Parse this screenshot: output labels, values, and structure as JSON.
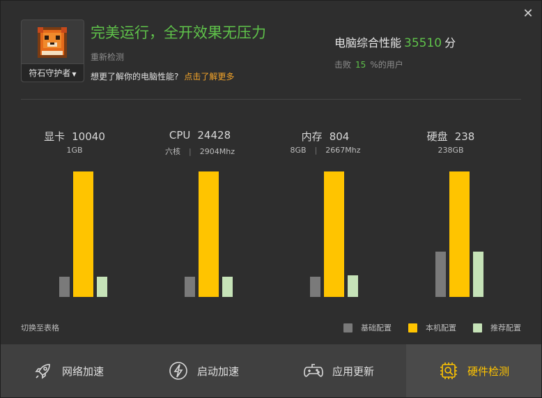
{
  "header": {
    "avatar_label": "符石守护者",
    "headline": "完美运行，全开效果无压力",
    "recheck": "重新检测",
    "learn_text": "想更了解你的电脑性能?",
    "learn_link": "点击了解更多",
    "score_label": "电脑综合性能",
    "score_value": "35510",
    "score_unit": "分",
    "beat_prefix": "击败",
    "beat_value": "15",
    "beat_suffix": "%的用户"
  },
  "chart_data": {
    "type": "bar",
    "categories": [
      "显卡",
      "CPU",
      "内存",
      "硬盘"
    ],
    "scores": [
      "10040",
      "24428",
      "804",
      "238"
    ],
    "specs": [
      [
        "1GB"
      ],
      [
        "六核",
        "2904Mhz"
      ],
      [
        "8GB",
        "2667Mhz"
      ],
      [
        "238GB"
      ]
    ],
    "series": [
      {
        "name": "基础配置",
        "values": [
          0.16,
          0.16,
          0.16,
          0.36
        ]
      },
      {
        "name": "本机配置",
        "values": [
          1.0,
          1.0,
          1.0,
          1.0
        ]
      },
      {
        "name": "推荐配置",
        "values": [
          0.16,
          0.16,
          0.17,
          0.36
        ]
      }
    ],
    "colors": [
      "#7a7a7a",
      "#ffc400",
      "#c6e3b8"
    ]
  },
  "footer": {
    "switch": "切换至表格",
    "legend": [
      "基础配置",
      "本机配置",
      "推荐配置"
    ]
  },
  "nav": [
    {
      "label": "网络加速",
      "icon": "rocket-icon"
    },
    {
      "label": "启动加速",
      "icon": "lightning-icon"
    },
    {
      "label": "应用更新",
      "icon": "gamepad-icon"
    },
    {
      "label": "硬件检测",
      "icon": "chip-search-icon"
    }
  ]
}
